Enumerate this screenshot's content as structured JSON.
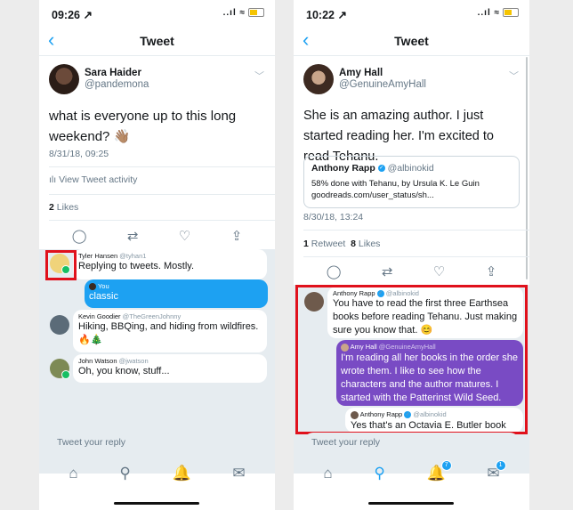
{
  "left": {
    "status": {
      "time": "09:26 ↗",
      "signal": "..ıl ≈"
    },
    "nav": {
      "title": "Tweet",
      "back_icon": "‹"
    },
    "tweet": {
      "author_name": "Sara Haider",
      "author_handle": "@pandemona",
      "text": "what is everyone up to this long weekend? 👋🏽",
      "timestamp": "8/31/18, 09:25",
      "activity_label": "View Tweet activity",
      "likes_count": "2",
      "likes_label": "Likes"
    },
    "conversation": [
      {
        "name": "Tyler Hansen",
        "handle": "@tyhan1",
        "text": "Replying to tweets. Mostly."
      },
      {
        "name": "You",
        "handle": "",
        "text": "classic"
      },
      {
        "name": "Kevin Goodier",
        "handle": "@TheGreenJohnny",
        "text": "Hiking, BBQing, and hiding from wildfires.",
        "emoji": "🔥🎄"
      },
      {
        "name": "John Watson",
        "handle": "@jwatson",
        "text": "Oh, you know, stuff..."
      }
    ],
    "reply_placeholder": "Tweet your reply",
    "tabs": [
      {
        "name": "home-icon",
        "glyph": "⌂"
      },
      {
        "name": "search-icon",
        "glyph": "⚲"
      },
      {
        "name": "notifications-icon",
        "glyph": "🔔"
      },
      {
        "name": "messages-icon",
        "glyph": "✉"
      }
    ]
  },
  "right": {
    "status": {
      "time": "10:22 ↗",
      "signal": "..ıl ≈"
    },
    "nav": {
      "title": "Tweet",
      "back_icon": "‹"
    },
    "tweet": {
      "author_name": "Amy Hall",
      "author_handle": "@GenuineAmyHall",
      "text": "She is an amazing author. I just started reading her.  I'm excited to read Tehanu.",
      "quote_name": "Anthony Rapp",
      "quote_handle": "@albinokid",
      "quote_text": "58% done with Tehanu, by Ursula K. Le Guin goodreads.com/user_status/sh...",
      "timestamp": "8/30/18, 13:24",
      "retweets_count": "1",
      "retweets_label": "Retweet",
      "likes_count": "8",
      "likes_label": "Likes"
    },
    "conversation": [
      {
        "name": "Anthony Rapp",
        "handle": "@albinokid",
        "text": "You have to read the first three Earthsea books before reading Tehanu. Just making sure you know that. 😊"
      },
      {
        "name": "Amy Hall",
        "handle": "@GenuineAmyHall",
        "text": "I'm reading all her books in the order she wrote them.  I like to see how the characters and the author matures.  I started with the Patterinst Wild Seed."
      },
      {
        "name": "Anthony Rapp",
        "handle": "@albinokid",
        "text": "Yes that's an Octavia E. Butler book"
      }
    ],
    "reply_placeholder": "Tweet your reply",
    "tabs": [
      {
        "name": "home-icon",
        "glyph": "⌂",
        "badge": ""
      },
      {
        "name": "search-icon",
        "glyph": "⚲",
        "badge": ""
      },
      {
        "name": "notifications-icon",
        "glyph": "🔔",
        "badge": "7"
      },
      {
        "name": "messages-icon",
        "glyph": "✉",
        "badge": "1"
      }
    ]
  },
  "colors": {
    "accent": "#1da1f2",
    "highlight_box": "#e0111c",
    "dm_purple": "#794bc4"
  }
}
